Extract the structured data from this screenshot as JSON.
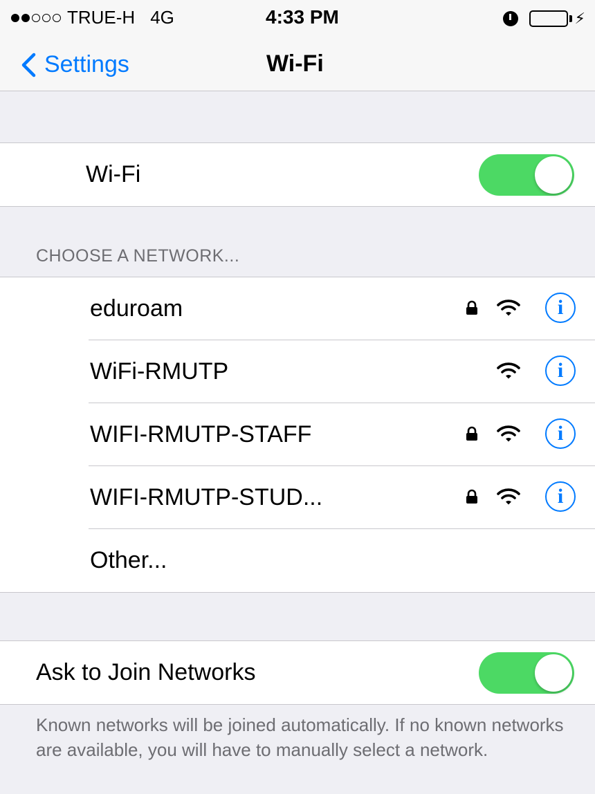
{
  "status_bar": {
    "signal_dots_filled": 2,
    "signal_dots_total": 5,
    "carrier": "TRUE-H",
    "network": "4G",
    "time": "4:33 PM",
    "alarm_icon": "alarm-clock-icon",
    "battery_icon": "battery-charging-icon",
    "battery_level": 1.0
  },
  "nav": {
    "back_label": "Settings",
    "title": "Wi-Fi"
  },
  "wifi_toggle": {
    "label": "Wi-Fi",
    "on": true
  },
  "networks": {
    "header": "CHOOSE A NETWORK...",
    "items": [
      {
        "name": "eduroam",
        "locked": true
      },
      {
        "name": "WiFi-RMUTP",
        "locked": false
      },
      {
        "name": "WIFI-RMUTP-STAFF",
        "locked": true
      },
      {
        "name": "WIFI-RMUTP-STUD...",
        "locked": true
      }
    ],
    "other_label": "Other...",
    "info_glyph": "i"
  },
  "ask_to_join": {
    "label": "Ask to Join Networks",
    "on": true,
    "footer": "Known networks will be joined automatically. If no known networks are available, you will have to manually select a network."
  },
  "colors": {
    "accent": "#007aff",
    "toggle_on": "#4cd964",
    "background": "#efeff4"
  }
}
